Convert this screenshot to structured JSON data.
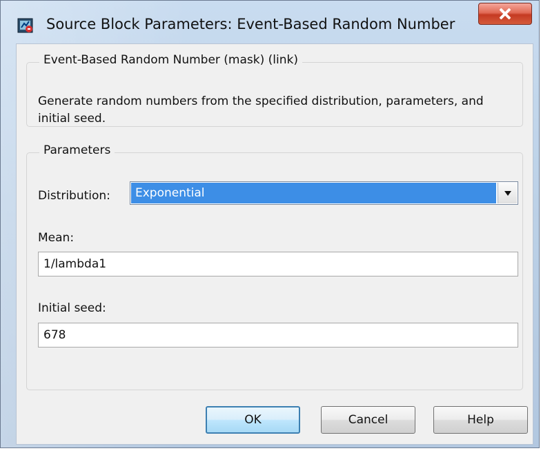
{
  "window": {
    "title": "Source Block Parameters: Event-Based Random Number",
    "icon": "simulink-block-icon",
    "close_icon": "close-icon"
  },
  "description_group": {
    "title": "Event-Based Random Number (mask) (link)",
    "text": "Generate random numbers from the specified distribution, parameters, and initial seed."
  },
  "parameters": {
    "title": "Parameters",
    "distribution_label": "Distribution:",
    "distribution_value": "Exponential",
    "mean_label": "Mean:",
    "mean_value": "1/lambda1",
    "initial_seed_label": "Initial seed:",
    "initial_seed_value": "678"
  },
  "buttons": {
    "ok": "OK",
    "cancel": "Cancel",
    "help": "Help"
  },
  "colors": {
    "selected_blue": "#3d8ee6",
    "title_bar": "#b9cfe6",
    "close_red": "#c53a22"
  }
}
